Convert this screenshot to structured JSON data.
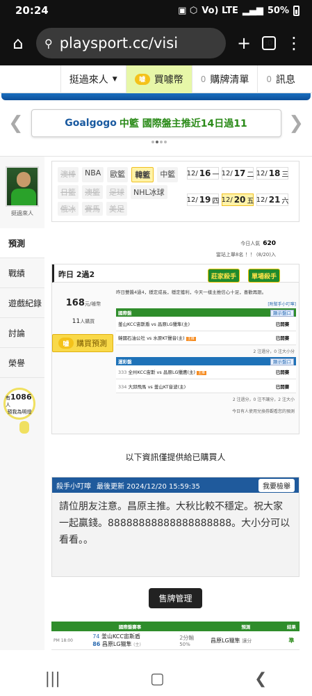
{
  "status": {
    "time": "20:24",
    "network": "Vo) LTE",
    "battery": "50%"
  },
  "browser": {
    "url": "playsport.cc/visi",
    "tab_count": ":D"
  },
  "topnav": {
    "user": "挺過來人",
    "coins_label": "買噱幣",
    "coin_icon_text": "噱",
    "card_list_count": "0",
    "card_list_label": "購牌清單",
    "msg_count": "0",
    "msg_label": "訊息"
  },
  "banner": {
    "title_en": "Goalgogo",
    "title_zh": "中籃 國際盤主推近14日過11"
  },
  "profile": {
    "name": "挺過來人"
  },
  "sidenav": [
    "預測",
    "戰績",
    "遊戲紀錄",
    "討論",
    "榮譽"
  ],
  "fans": {
    "prefix": "有",
    "count": "1086",
    "unit": "人",
    "label": "預我為明燈"
  },
  "leagues": [
    {
      "label": "澳棒",
      "state": "dim"
    },
    {
      "label": "NBA",
      "state": "normal"
    },
    {
      "label": "歐籃",
      "state": "normal"
    },
    {
      "label": "韓籃",
      "state": "on"
    },
    {
      "label": "中籃",
      "state": "normal"
    },
    {
      "label": "日籃",
      "state": "dim"
    },
    {
      "label": "澳籃",
      "state": "dim"
    },
    {
      "label": "足球",
      "state": "dim"
    },
    {
      "label": "NHL冰球",
      "state": "normal"
    },
    {
      "label": "俄冰",
      "state": "dim"
    },
    {
      "label": "賽馬",
      "state": "dim"
    },
    {
      "label": "美足",
      "state": "dim"
    }
  ],
  "dates": [
    {
      "md": "12/",
      "d": "16",
      "wd": "一",
      "active": false
    },
    {
      "md": "12/",
      "d": "17",
      "wd": "二",
      "active": false
    },
    {
      "md": "12/",
      "d": "18",
      "wd": "三",
      "active": false
    },
    {
      "md": "12/",
      "d": "19",
      "wd": "四",
      "active": false
    },
    {
      "md": "12/",
      "d": "20",
      "wd": "五",
      "active": true
    },
    {
      "md": "12/",
      "d": "21",
      "wd": "六",
      "active": false
    }
  ],
  "stats": {
    "today_label": "今日人氣",
    "today_value": "620",
    "rank_label": "當站上單8名 ！！",
    "rank_note": "(8/20)入"
  },
  "prediction": {
    "header": "昨日 2過2",
    "badge1": "莊家殺手",
    "badge2": "單場殺手",
    "price_value": "168",
    "price_unit": "元/噱幣",
    "buyers_value": "11",
    "buyers_unit": "人購買",
    "buy_label": "購買預測",
    "desc": "昨日雙醬4過4，穩定成長，穩定獲利，今天一樣主推信心十足，喜歡再跟。",
    "aux_link": "[附幫手小叮嚀]",
    "intl_title": "國際盤",
    "intl_btn": "顯示盤口",
    "intl_rows": [
      {
        "home": "釜山KCC宙斯盾",
        "away": "昌原LG獵隼(主)",
        "tag": "",
        "result": "已開賽"
      },
      {
        "home": "韓國石油公社",
        "away": "水原KT聲音(主)",
        "tag": "主推",
        "result": "已開賽"
      }
    ],
    "intl_foot": "2 注過分，0 注大小分",
    "lottery_title": "運彩盤",
    "lottery_btn": "顯示盤口",
    "lottery_rows": [
      {
        "num": "333",
        "home": "全州KCC宙斯",
        "away": "昌原LG獵鷹(主)",
        "tag": "主推",
        "result": "已開賽"
      },
      {
        "num": "334",
        "home": "大邱飛馬",
        "away": "釜山KT音波(主)",
        "tag": "",
        "result": "已開賽"
      }
    ],
    "lottery_foot": "2 注過分，0 注不讓分，2 注大小",
    "bottom_note": "今日有人使用兌換券觀看您的預測"
  },
  "notice": "以下資訊僅提供給已購買人",
  "talk": {
    "title": "殺手小叮嚀",
    "updated_label": "最後更新 2024/12/20 15:59:35",
    "btn": "我要檢舉",
    "body": "請位朋友注意。昌原主推。大秋比較不穩定。祝大家一起贏錢。88888888888888888888。大小分可以看看。。"
  },
  "mgmt_label": "售牌管理",
  "results": {
    "headers": [
      "國際盤賽事",
      "預測",
      "結果"
    ],
    "rows": [
      {
        "time": "PM 18:00",
        "num1": "74",
        "team1": "釜山KCC宙斯盾",
        "num2": "86",
        "team2": "昌原LG獵隼",
        "team2_note": "(主)",
        "line": "2分輸",
        "pct": "50%",
        "pick": "昌原LG獵隼",
        "pick_note": "讓分",
        "result": "準"
      }
    ]
  },
  "colors": {
    "brand_green": "#2f8d2b",
    "brand_blue": "#1f5a9c",
    "accent_yellow": "#f9d949"
  }
}
